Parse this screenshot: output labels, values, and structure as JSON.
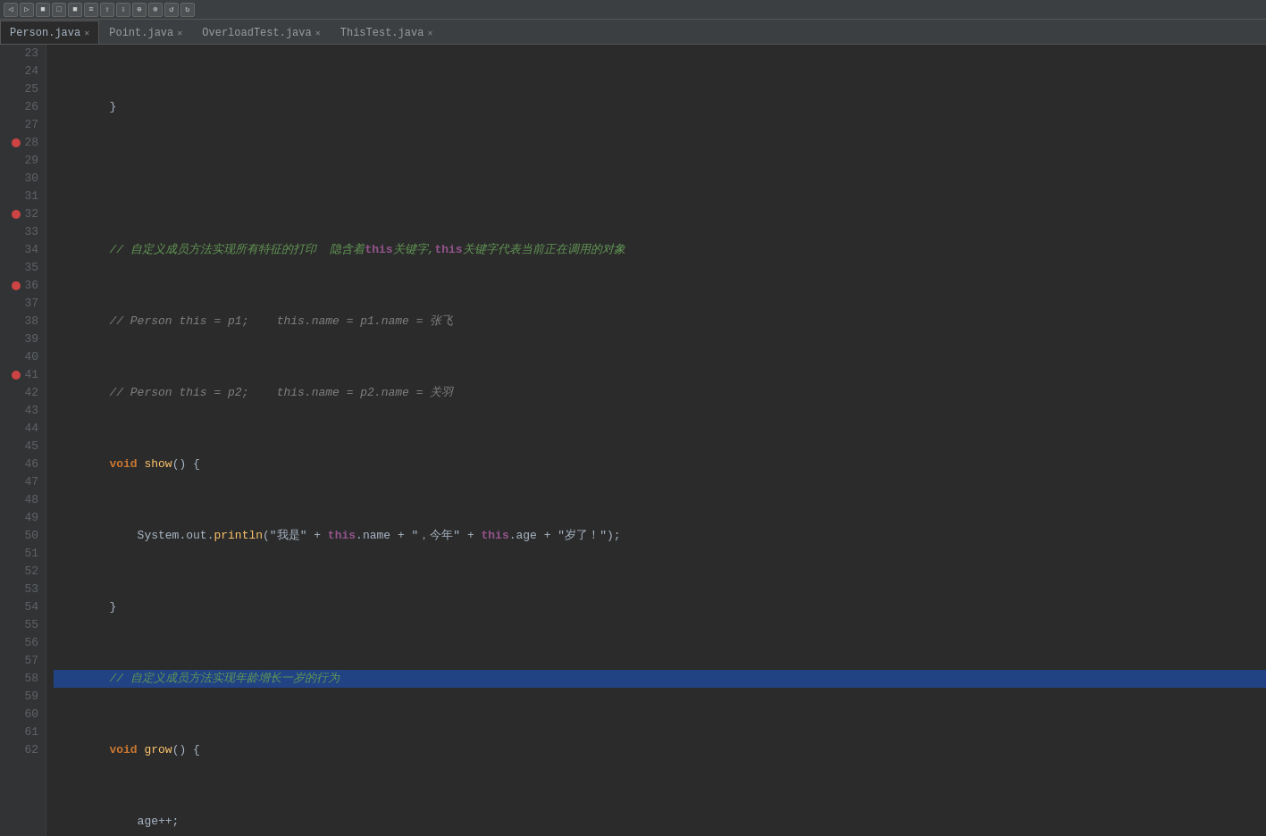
{
  "toolbar": {
    "buttons": [
      "◀",
      "▶",
      "⬛",
      "⬜",
      "⬛",
      "⬜",
      "◀",
      "▶",
      "⬛",
      "⬜",
      "⬜",
      "⬜",
      "⬜",
      "⬜"
    ]
  },
  "tabs": [
    {
      "label": "Person.java",
      "active": true
    },
    {
      "label": "Point.java",
      "active": false
    },
    {
      "label": "OverloadTest.java",
      "active": false
    },
    {
      "label": "ThisTest.java",
      "active": false
    }
  ],
  "lines": {
    "start": 23,
    "count": 40
  }
}
